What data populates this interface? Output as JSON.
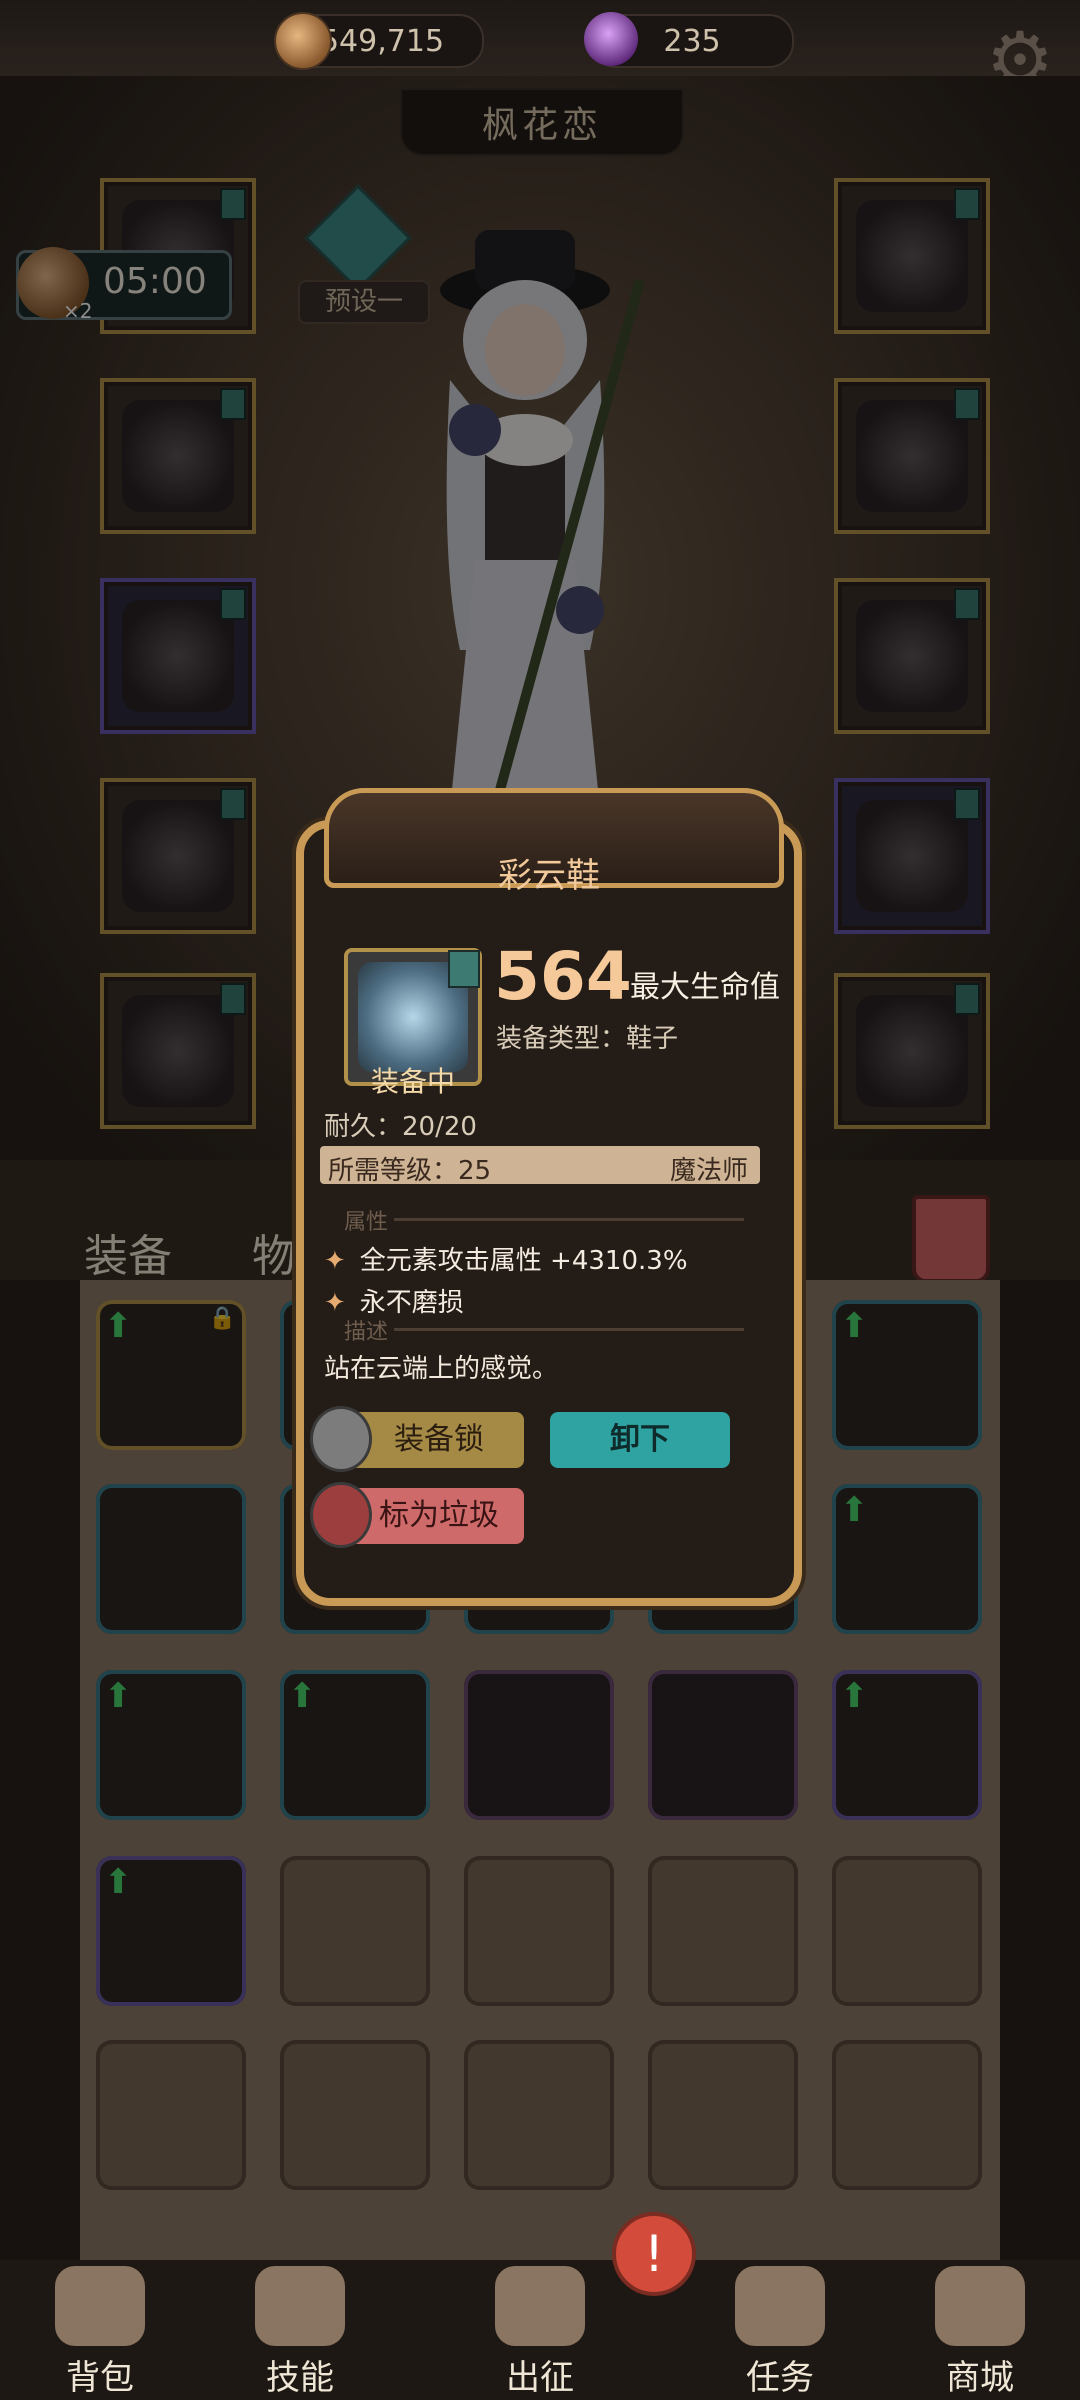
{
  "resources": {
    "gold": "549,715",
    "gems": "235"
  },
  "character_name": "枫花恋",
  "preset_label": "预设一",
  "boost_timer": {
    "time": "05:00",
    "multiplier": "×2"
  },
  "tabs": {
    "equip": "装备",
    "items": "物品"
  },
  "tooltip": {
    "title": "彩云鞋",
    "stat_value": "564",
    "stat_label": "最大生命值",
    "equip_type": "装备类型：鞋子",
    "equipped_badge": "装备中",
    "durability": "耐久：20/20",
    "required_level": "所需等级：25",
    "class": "魔法师",
    "section_attr": "属性",
    "attributes": [
      "全元素攻击属性 +4310.3%",
      "永不磨损"
    ],
    "section_desc": "描述",
    "description": "站在云端上的感觉。",
    "buttons": {
      "lock": "装备锁",
      "unequip": "卸下",
      "mark_junk": "标为垃圾"
    }
  },
  "nav": {
    "bag": "背包",
    "skills": "技能",
    "battle": "出征",
    "tasks": "任务",
    "shop": "商城",
    "alert_mark": "!"
  },
  "icons": {
    "gear": "⚙",
    "star": "✦",
    "up_arrow": "⬆",
    "lock": "🔒"
  }
}
